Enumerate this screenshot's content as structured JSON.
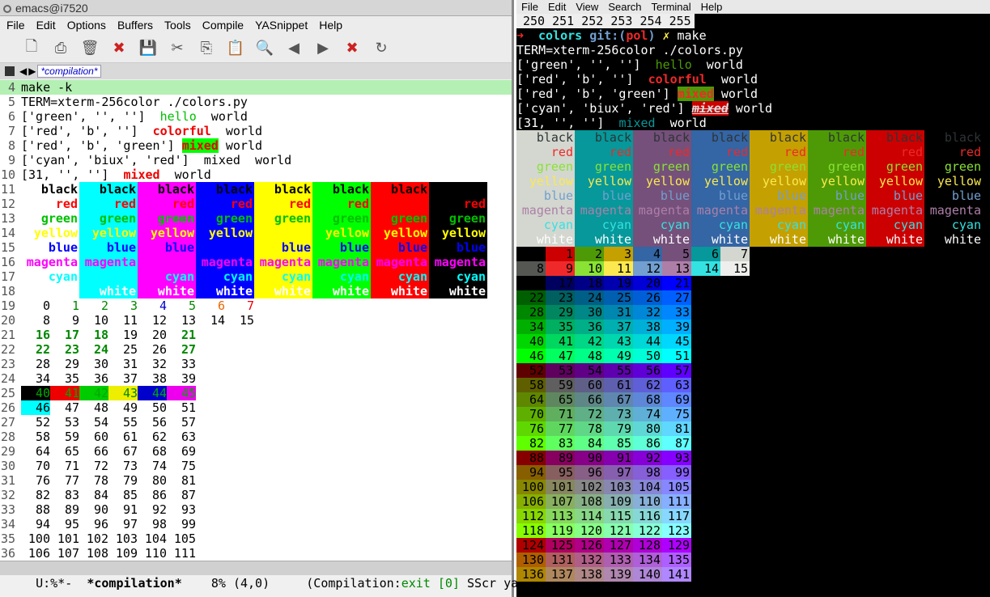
{
  "emacs": {
    "title": "emacs@i7520",
    "menu": [
      "File",
      "Edit",
      "Options",
      "Buffers",
      "Tools",
      "Compile",
      "YASnippet",
      "Help"
    ],
    "toolbar": [
      "new-file-icon",
      "print-icon",
      "trash-icon",
      "close-icon",
      "save-icon",
      "cut-icon",
      "copy-icon",
      "paste-icon",
      "search-icon",
      "back-arrow-icon",
      "forward-arrow-icon",
      "cancel-icon",
      "reload-icon"
    ],
    "tab_label": "*compilation*",
    "cmd": "make -k",
    "term_line": "TERM=xterm-256color ./colors.py",
    "samples": [
      {
        "pre": "['green', '', '']  ",
        "word": "hello",
        "post": "  world"
      },
      {
        "pre": "['red', 'b', '']  ",
        "word": "colorful",
        "post": "  world"
      },
      {
        "pre": "['red', 'b', 'green'] ",
        "word": "mixed",
        "post": " world"
      },
      {
        "pre": "['cyan', 'biux', 'red']  ",
        "word": "mixed",
        "post": "  world"
      },
      {
        "pre": "[31, '', '']  ",
        "word": "mixed",
        "post": "  world"
      }
    ],
    "bgs": [
      "#ffffff",
      "#00ffff",
      "#ff00ff",
      "#0000ff",
      "#ffff00",
      "#00ff00",
      "#ff0000",
      "#000000"
    ],
    "words": [
      "black",
      "red",
      "green",
      "yellow",
      "blue",
      "magenta",
      "cyan",
      "white"
    ],
    "fgs": [
      "#000000",
      "#ff0000",
      "#00c000",
      "#ffff00",
      "#0000ff",
      "#ff00ff",
      "#00ffff",
      "#ffffff"
    ],
    "grid_rows": [
      [
        "0",
        "1",
        "2",
        "3",
        "4",
        "5",
        "6",
        "7"
      ],
      [
        "8",
        "9",
        "10",
        "11",
        "12",
        "13",
        "14",
        "15"
      ],
      [
        "16",
        "17",
        "18",
        "19",
        "20",
        "21"
      ],
      [
        "22",
        "23",
        "24",
        "25",
        "26",
        "27"
      ],
      [
        "28",
        "29",
        "30",
        "31",
        "32",
        "33"
      ],
      [
        "34",
        "35",
        "36",
        "37",
        "38",
        "39"
      ],
      [
        "40",
        "41",
        "42",
        "43",
        "44",
        "45"
      ],
      [
        "46",
        "47",
        "48",
        "49",
        "50",
        "51"
      ],
      [
        "52",
        "53",
        "54",
        "55",
        "56",
        "57"
      ],
      [
        "58",
        "59",
        "60",
        "61",
        "62",
        "63"
      ],
      [
        "64",
        "65",
        "66",
        "67",
        "68",
        "69"
      ],
      [
        "70",
        "71",
        "72",
        "73",
        "74",
        "75"
      ],
      [
        "76",
        "77",
        "78",
        "79",
        "80",
        "81"
      ],
      [
        "82",
        "83",
        "84",
        "85",
        "86",
        "87"
      ],
      [
        "88",
        "89",
        "90",
        "91",
        "92",
        "93"
      ],
      [
        "94",
        "95",
        "96",
        "97",
        "98",
        "99"
      ],
      [
        "100",
        "101",
        "102",
        "103",
        "104",
        "105"
      ],
      [
        "106",
        "107",
        "108",
        "109",
        "110",
        "111"
      ]
    ],
    "first_line_no": 4,
    "modeline": {
      "left": "U:%*-  ",
      "buf": "*compilation*",
      "pos": "    8% (4,0)     ",
      "mode": "(Compilation:",
      "exit": "exit [0]",
      "rest": " SScr yas"
    }
  },
  "terminal": {
    "menu": [
      "File",
      "Edit",
      "View",
      "Search",
      "Terminal",
      "Help"
    ],
    "top_line": "250 251 252 253 254 255",
    "prompt_arrow": "➜",
    "prompt_dir": "colors",
    "prompt_git": "git:(",
    "prompt_branch": "pol",
    "prompt_close": ")",
    "prompt_x": "✗",
    "prompt_cmd": "make",
    "term_line": "TERM=xterm-256color ./colors.py",
    "samples": [
      {
        "pre": "['green', '', '']  ",
        "word": "hello",
        "post": "  world"
      },
      {
        "pre": "['red', 'b', '']  ",
        "word": "colorful",
        "post": "  world"
      },
      {
        "pre": "['red', 'b', 'green'] ",
        "word": "mixed",
        "post": " world"
      },
      {
        "pre": "['cyan', 'biux', 'red'] ",
        "word": "mixed",
        "post": " world"
      },
      {
        "pre": "[31, '', '']  ",
        "word": "mixed",
        "post": "  world"
      }
    ],
    "bgs": [
      "#d3d7cf",
      "#06989a",
      "#75507b",
      "#3465a4",
      "#c4a000",
      "#4e9a06",
      "#cc0000",
      "#000000"
    ],
    "words": [
      "black",
      "red",
      "green",
      "yellow",
      "blue",
      "magenta",
      "cyan",
      "white"
    ],
    "fgs": [
      "#2e3436",
      "#ef2929",
      "#8ae234",
      "#fce94f",
      "#729fcf",
      "#ad7fa8",
      "#34e2e2",
      "#ffffff"
    ],
    "grid_rows": [
      [
        "0",
        "1",
        "2",
        "3",
        "4",
        "5",
        "6",
        "7"
      ],
      [
        "8",
        "9",
        "10",
        "11",
        "12",
        "13",
        "14",
        "15"
      ],
      [
        "16",
        "17",
        "18",
        "19",
        "20",
        "21"
      ],
      [
        "22",
        "23",
        "24",
        "25",
        "26",
        "27"
      ],
      [
        "28",
        "29",
        "30",
        "31",
        "32",
        "33"
      ],
      [
        "34",
        "35",
        "36",
        "37",
        "38",
        "39"
      ],
      [
        "40",
        "41",
        "42",
        "43",
        "44",
        "45"
      ],
      [
        "46",
        "47",
        "48",
        "49",
        "50",
        "51"
      ],
      [
        "52",
        "53",
        "54",
        "55",
        "56",
        "57"
      ],
      [
        "58",
        "59",
        "60",
        "61",
        "62",
        "63"
      ],
      [
        "64",
        "65",
        "66",
        "67",
        "68",
        "69"
      ],
      [
        "70",
        "71",
        "72",
        "73",
        "74",
        "75"
      ],
      [
        "76",
        "77",
        "78",
        "79",
        "80",
        "81"
      ],
      [
        "82",
        "83",
        "84",
        "85",
        "86",
        "87"
      ],
      [
        "88",
        "89",
        "90",
        "91",
        "92",
        "93"
      ],
      [
        "94",
        "95",
        "96",
        "97",
        "98",
        "99"
      ],
      [
        "100",
        "101",
        "102",
        "103",
        "104",
        "105"
      ],
      [
        "106",
        "107",
        "108",
        "109",
        "110",
        "111"
      ],
      [
        "112",
        "113",
        "114",
        "115",
        "116",
        "117"
      ],
      [
        "118",
        "119",
        "120",
        "121",
        "122",
        "123"
      ],
      [
        "124",
        "125",
        "126",
        "127",
        "128",
        "129"
      ],
      [
        "130",
        "131",
        "132",
        "133",
        "134",
        "135"
      ],
      [
        "136",
        "137",
        "138",
        "139",
        "140",
        "141"
      ]
    ]
  }
}
